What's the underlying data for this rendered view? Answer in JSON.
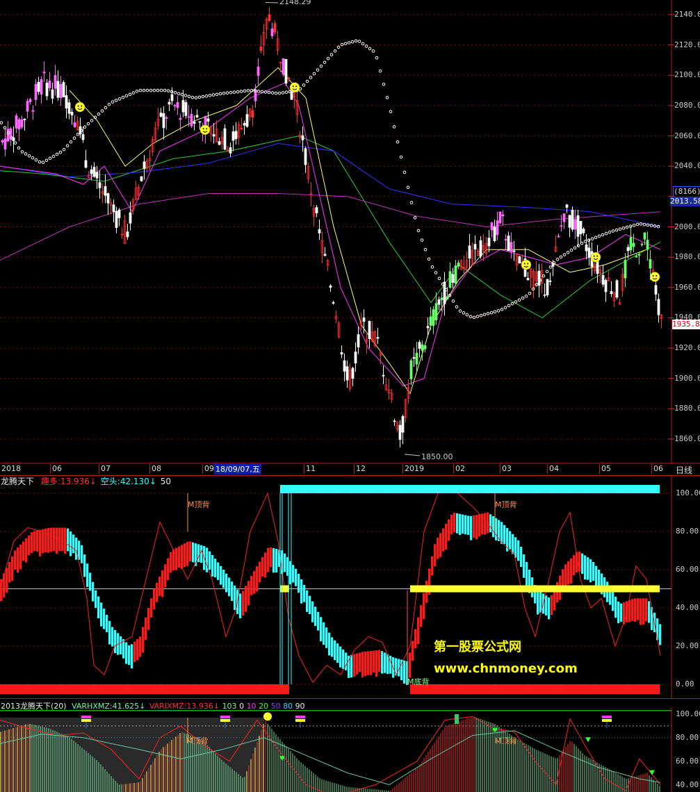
{
  "main": {
    "high_label": "2148.29",
    "low_label": "1850.00",
    "price_axis": [
      "2140.00",
      "2120.00",
      "2100.00",
      "2080.00",
      "2060.00",
      "2040.00",
      "2000.00",
      "1980.00",
      "1960.00",
      "1940.00",
      "1920.00",
      "1900.00",
      "1880.00",
      "1860.00"
    ],
    "count_badge": "(8166)",
    "current_price_box": "2013.58",
    "last_price_box": "1935.8",
    "colors": {
      "up": "#ff3030",
      "down": "#ffffff",
      "pink": "#ff66ff",
      "green": "#66ff66",
      "ma_yellow": "#ffff66",
      "ma_magenta": "#ff33ff",
      "ma_blue": "#3333ff",
      "ma_green": "#33cc33",
      "dotted": "#ffffff"
    }
  },
  "date_axis": {
    "labels": [
      "2018",
      "06",
      "07",
      "08",
      "09",
      "11",
      "12",
      "2019",
      "02",
      "03",
      "04",
      "05",
      "06"
    ],
    "cursor_date": "18/09/07,五",
    "period": "日线"
  },
  "panel1": {
    "title": "龙腾天下",
    "bull_label": "趣多:",
    "bull_value": "13.936",
    "bull_arrow": "↓",
    "bear_label": "空头:",
    "bear_value": "42.130",
    "bear_arrow": "↓",
    "mid_value": "50",
    "axis": [
      "100.00",
      "80.00",
      "60.00",
      "40.00",
      "20.00",
      "0.00"
    ],
    "annotations": [
      "M顶背",
      "M顶背",
      "M底背"
    ],
    "watermark_cn": "第一股票公式网",
    "watermark_url": "www.chnmoney.com",
    "colors": {
      "red": "#ff1a1a",
      "cyan": "#33ffff",
      "yellow": "#ffff33",
      "line": "#ff3030"
    }
  },
  "panel2": {
    "title": "2013龙腾天下(20)",
    "var1_label": "VARHXMZ:",
    "var1_value": "41.625",
    "var1_arrow": "↓",
    "var2_label": "VARIXMZ:",
    "var2_value": "13.936",
    "var2_arrow": "↓",
    "levels": [
      "103",
      "0",
      "10",
      "20",
      "50",
      "80",
      "90"
    ],
    "axis": [
      "100.00",
      "80.00",
      "60.00",
      "40.00"
    ],
    "annotations": [
      "M顶背",
      "M顶背"
    ]
  }
}
